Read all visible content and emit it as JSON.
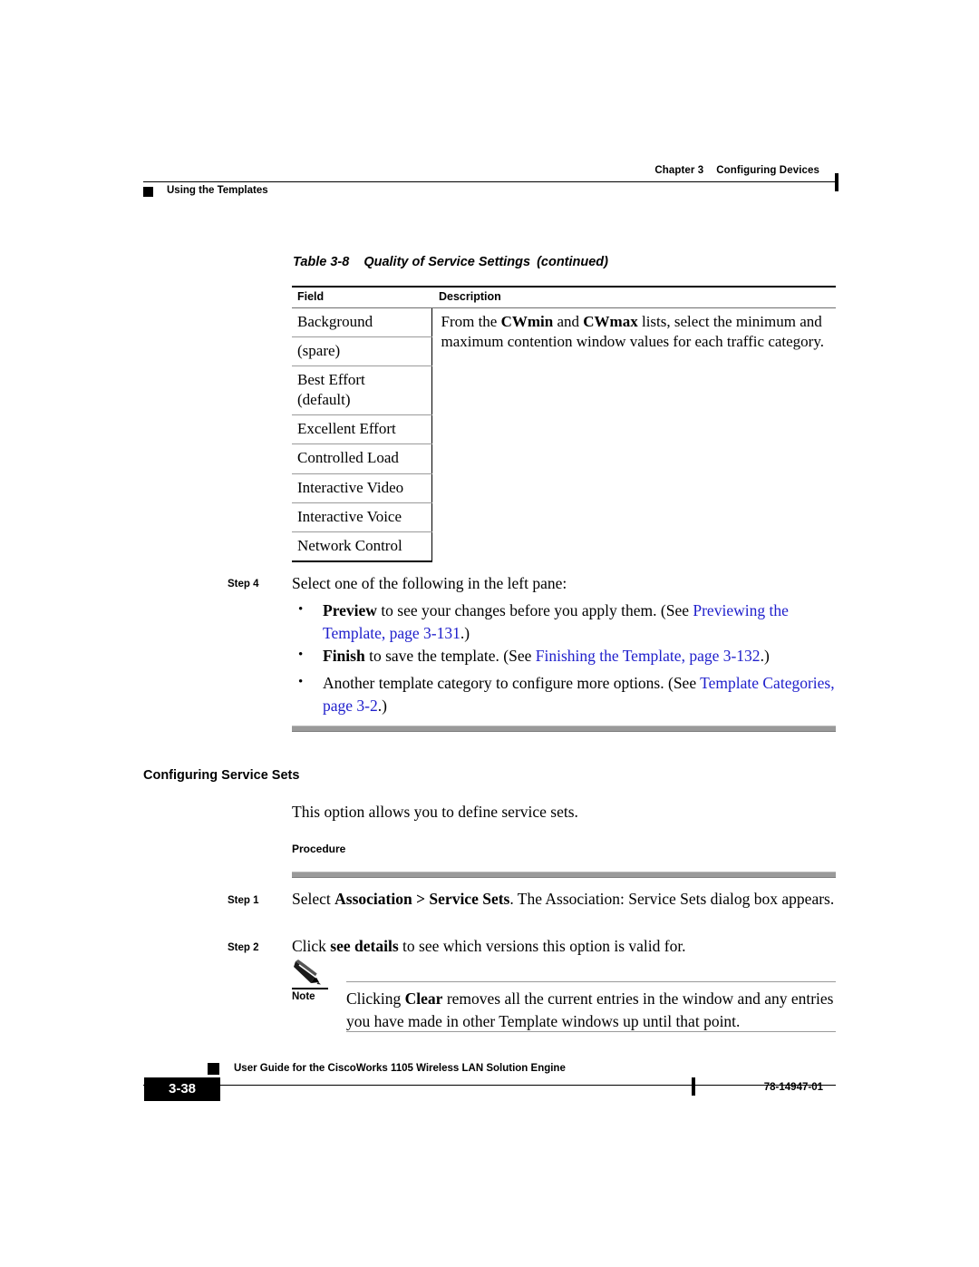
{
  "header": {
    "chapter": "Chapter 3",
    "chapter_title": "Configuring Devices",
    "section": "Using the Templates"
  },
  "table": {
    "label": "Table 3-8",
    "title": "Quality of Service Settings",
    "continued": "(continued)",
    "columns": [
      "Field",
      "Description"
    ],
    "description_text_pre": "From the ",
    "description_bold_1": "CWmin",
    "description_mid": " and ",
    "description_bold_2": "CWmax",
    "description_text_post": " lists, select the minimum and maximum contention window values for each traffic category.",
    "fields": [
      "Background",
      "(spare)",
      "Best Effort\n(default)",
      "Excellent Effort",
      "Controlled Load",
      "Interactive Video",
      "Interactive Voice",
      "Network Control"
    ]
  },
  "step4": {
    "label": "Step 4",
    "intro": "Select one of the following in the left pane:",
    "bullets": [
      {
        "bold": "Preview",
        "text": " to see your changes before you apply them. (See ",
        "link": "Previewing the Template, page 3-131",
        "tail": ".)"
      },
      {
        "bold": "Finish",
        "text": " to save the template. (See ",
        "link": "Finishing the Template, page 3-132",
        "tail": ".)"
      },
      {
        "bold": "",
        "text": "Another template category to configure more options. (See ",
        "link": "Template Categories, page 3-2",
        "tail": ".)"
      }
    ]
  },
  "section": {
    "heading": "Configuring Service Sets",
    "intro": "This option allows you to define service sets.",
    "procedure_label": "Procedure"
  },
  "step1": {
    "label": "Step 1",
    "pre": "Select ",
    "bold": "Association > Service Sets",
    "post": ". The Association: Service Sets dialog box appears."
  },
  "step2": {
    "label": "Step 2",
    "pre": "Click ",
    "bold": "see details",
    "post": " to see which versions this option is valid for."
  },
  "note": {
    "label": "Note",
    "icon": "pencil-icon",
    "pre": "Clicking ",
    "bold": "Clear",
    "post": " removes all the current entries in the window and any entries you have made in other Template windows up until that point."
  },
  "footer": {
    "guide_title": "User Guide for the CiscoWorks 1105 Wireless LAN Solution Engine",
    "page_number": "3-38",
    "doc_number": "78-14947-01"
  },
  "colors": {
    "link": "#2020cc",
    "rule_gray": "#9a9a9a",
    "black": "#000000"
  }
}
